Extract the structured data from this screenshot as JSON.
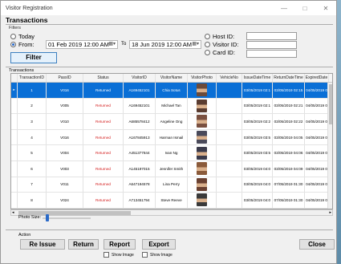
{
  "window": {
    "title": "Visitor Registration",
    "controls": [
      "—",
      "□",
      "✕"
    ]
  },
  "section_title": "Transactions",
  "filters": {
    "label": "Filters",
    "today_label": "Today",
    "from_label": "From:",
    "from_date": "01 Feb 2019  12:00 AM",
    "to_label": "To",
    "to_date": "18 Jun 2019  12:00 AM",
    "host_label": "Host ID:",
    "visitor_label": "Visitor ID:",
    "card_label": "Card ID:",
    "filter_button": "Filter"
  },
  "transactions_label": "Transactions",
  "table": {
    "columns": [
      "TransactionID",
      "PassID",
      "Status",
      "VisitorID",
      "VisitorName",
      "VisitorPhoto",
      "VehicleNo",
      "IssueDateTime",
      "ReturnDateTime",
      "ExpiredDate"
    ],
    "rows": [
      {
        "id": "1",
        "pass": "V016",
        "status": "Returned",
        "visitor": "A169452101",
        "name": "Chia Sotus",
        "issue": "03/05/2019 02:1",
        "ret": "03/05/2019 02:15",
        "exp": "04/05/2019 0",
        "photo_color": "#6b4a3a"
      },
      {
        "id": "2",
        "pass": "V005",
        "status": "Returned",
        "visitor": "A169452101",
        "name": "Michael Tan",
        "issue": "03/05/2019 02:1",
        "ret": "03/05/2019 02:21",
        "exp": "04/05/2019 0",
        "photo_color": "#5a3c30"
      },
      {
        "id": "3",
        "pass": "V010",
        "status": "Returned",
        "visitor": "A685578412",
        "name": "Angeline Ong",
        "issue": "03/05/2019 02:2",
        "ret": "03/05/2019 02:22",
        "exp": "04/05/2019 0",
        "photo_color": "#7a5040"
      },
      {
        "id": "4",
        "pass": "V016",
        "status": "Returned",
        "visitor": "A167845913",
        "name": "Harman Ismail",
        "issue": "03/05/2019 03:5",
        "ret": "03/05/2019 04:05",
        "exp": "04/05/2019 0",
        "photo_color": "#4a4a5a"
      },
      {
        "id": "5",
        "pass": "V004",
        "status": "Returned",
        "visitor": "A451377844",
        "name": "Ivan Ng",
        "issue": "03/05/2019 03:5",
        "ret": "03/05/2019 04:06",
        "exp": "04/05/2019 0",
        "photo_color": "#3a3a4a"
      },
      {
        "id": "6",
        "pass": "V003",
        "status": "Returned",
        "visitor": "A145197015",
        "name": "Jennifer Smith",
        "issue": "03/05/2019 04:0",
        "ret": "03/05/2019 04:09",
        "exp": "04/05/2019 0",
        "photo_color": "#8a5a3a"
      },
      {
        "id": "7",
        "pass": "V011",
        "status": "Returned",
        "visitor": "A647194578",
        "name": "Lina Perry",
        "issue": "03/05/2019 04:0",
        "ret": "07/05/2019 01:30",
        "exp": "04/05/2019 0",
        "photo_color": "#6a4030"
      },
      {
        "id": "8",
        "pass": "V024",
        "status": "Returned",
        "visitor": "A713451794",
        "name": "Steve Reeve",
        "issue": "03/05/2019 04:0",
        "ret": "07/05/2019 01:30",
        "exp": "04/05/2019 0",
        "photo_color": "#3a3a3a"
      }
    ]
  },
  "photo_size_label": "Photo Size:",
  "photo_size_value": 0.07,
  "action": {
    "label": "Action",
    "reissue": "Re Issue",
    "return": "Return",
    "report": "Report",
    "export": "Export",
    "close": "Close",
    "show_image_1": "Show Image",
    "show_image_2": "Show Image"
  },
  "colors": {
    "selected_row": "#0a6fd6",
    "status_text": "#d42020"
  }
}
